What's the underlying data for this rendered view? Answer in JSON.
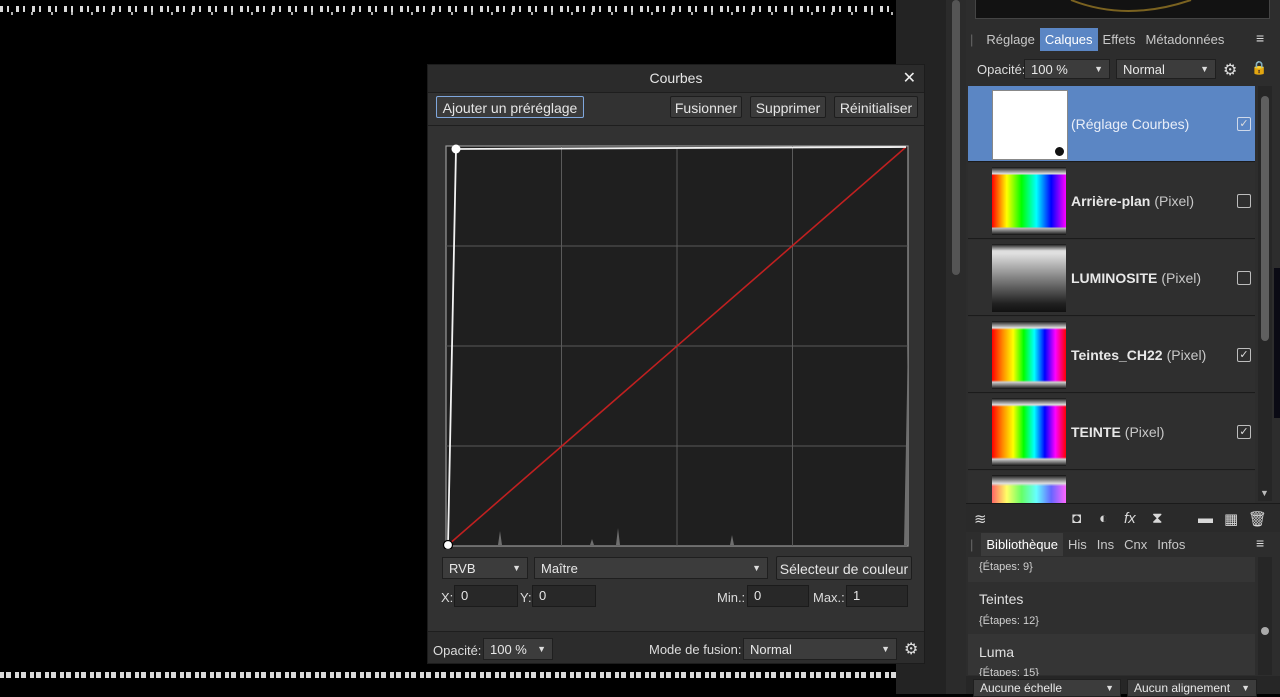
{
  "dialog": {
    "title": "Courbes",
    "buttons": {
      "add_preset": "Ajouter un préréglage",
      "merge": "Fusionner",
      "delete": "Supprimer",
      "reset": "Réinitialiser"
    },
    "channel_mode": "RVB",
    "channel": "Maître",
    "color_picker": "Sélecteur de couleur",
    "x_label": "X:",
    "x_value": "0",
    "y_label": "Y:",
    "y_value": "0",
    "min_label": "Min.:",
    "min_value": "0",
    "max_label": "Max.:",
    "max_value": "1",
    "opacity_label": "Opacité:",
    "opacity_value": "100 %",
    "blend_label": "Mode de fusion:",
    "blend_value": "Normal",
    "curve_colors": {
      "master": "#ffffff",
      "diagonal": "#c02020"
    }
  },
  "panel": {
    "tabs": [
      "Réglage",
      "Calques",
      "Effets",
      "Métadonnées"
    ],
    "active_tab": "Calques",
    "opacity_label": "Opacité:",
    "opacity_value": "100 %",
    "blend_value": "Normal",
    "layers": [
      {
        "name": "",
        "sub": "(Réglage Courbes)",
        "checked": true,
        "selected": true,
        "thumb": "white"
      },
      {
        "name": "Arrière-plan",
        "sub": "(Pixel)",
        "checked": false,
        "selected": false,
        "thumb": "spectrum"
      },
      {
        "name": "LUMINOSITE",
        "sub": "(Pixel)",
        "checked": false,
        "selected": false,
        "thumb": "gray"
      },
      {
        "name": "Teintes_CH22",
        "sub": "(Pixel)",
        "checked": true,
        "selected": false,
        "thumb": "hue"
      },
      {
        "name": "TEINTE",
        "sub": "(Pixel)",
        "checked": true,
        "selected": false,
        "thumb": "hue"
      }
    ],
    "bottom_tabs": [
      "Bibliothèque",
      "His",
      "Ins",
      "Cnx",
      "Infos"
    ],
    "active_bottom_tab": "Bibliothèque",
    "library": [
      {
        "name": "",
        "steps": "{Étapes: 9}"
      },
      {
        "name": "Teintes",
        "steps": "{Étapes: 12}"
      },
      {
        "name": "Luma",
        "steps": "{Étapes: 15}"
      }
    ],
    "footer": {
      "scale": "Aucune échelle",
      "align": "Aucun alignement"
    }
  }
}
